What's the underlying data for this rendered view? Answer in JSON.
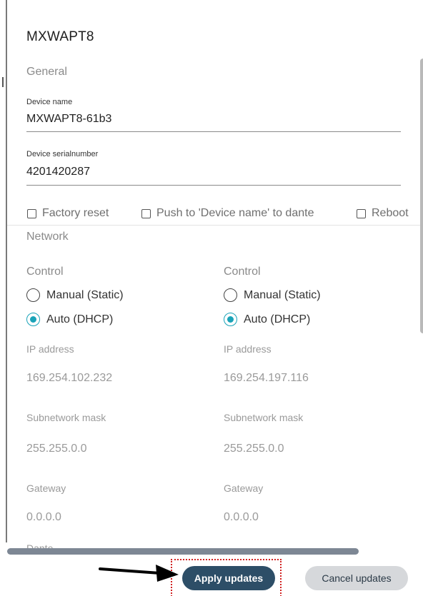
{
  "dialog": {
    "title": "MXWAPT8"
  },
  "general": {
    "section_label": "General",
    "device_name": {
      "label": "Device name",
      "value": "MXWAPT8-61b3"
    },
    "device_serial": {
      "label": "Device serialnumber",
      "value": "4201420287"
    },
    "options": [
      {
        "label": "Factory reset",
        "checked": false
      },
      {
        "label": "Push to 'Device name' to dante",
        "checked": false
      },
      {
        "label": "Reboot",
        "checked": false
      }
    ]
  },
  "network": {
    "section_label": "Network",
    "columns": [
      {
        "control_label": "Control",
        "manual_label": "Manual (Static)",
        "auto_label": "Auto (DHCP)",
        "selected": "auto",
        "ip_label": "IP address",
        "ip_value": "169.254.102.232",
        "mask_label": "Subnetwork mask",
        "mask_value": "255.255.0.0",
        "gateway_label": "Gateway",
        "gateway_value": "0.0.0.0"
      },
      {
        "control_label": "Control",
        "manual_label": "Manual (Static)",
        "auto_label": "Auto (DHCP)",
        "selected": "auto",
        "ip_label": "IP address",
        "ip_value": "169.254.197.116",
        "mask_label": "Subnetwork mask",
        "mask_value": "255.255.0.0",
        "gateway_label": "Gateway",
        "gateway_value": "0.0.0.0"
      }
    ]
  },
  "footer": {
    "apply_label": "Apply updates",
    "cancel_label": "Cancel updates"
  },
  "colors": {
    "accent": "#1aa3b8",
    "primary_button": "#2d4e67",
    "secondary_button": "#d6d8db",
    "highlight": "#d02020"
  }
}
